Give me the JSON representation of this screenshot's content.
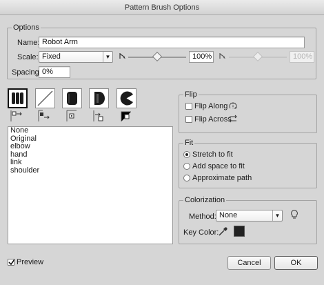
{
  "window": {
    "title": "Pattern Brush Options"
  },
  "options": {
    "legend": "Options",
    "name_label": "Name:",
    "name_value": "Robot Arm",
    "scale_label": "Scale:",
    "scale_selected": "Fixed",
    "scale_value": "100%",
    "scale_slider_level": 0.5,
    "scale_max_value": "100%",
    "scale_max_slider_level": 0.5,
    "spacing_label": "Spacing:",
    "spacing_value": "0%"
  },
  "tiles": [
    {
      "name": "side-tile",
      "selected": true
    },
    {
      "name": "outer-corner-tile",
      "selected": false
    },
    {
      "name": "inner-corner-tile",
      "selected": false
    },
    {
      "name": "start-tile",
      "selected": false
    },
    {
      "name": "end-tile",
      "selected": false
    }
  ],
  "pattern_list": {
    "items": [
      "None",
      "Original",
      "elbow",
      "hand",
      "link",
      "shoulder"
    ]
  },
  "flip": {
    "legend": "Flip",
    "flip_along_label": "Flip Along",
    "flip_along_checked": false,
    "flip_across_label": "Flip Across",
    "flip_across_checked": false
  },
  "fit": {
    "legend": "Fit",
    "options": [
      "Stretch to fit",
      "Add space to fit",
      "Approximate path"
    ],
    "selected_index": 0
  },
  "colorization": {
    "legend": "Colorization",
    "method_label": "Method:",
    "method_selected": "None",
    "key_color_label": "Key Color:",
    "key_color": "#222222"
  },
  "footer": {
    "preview_label": "Preview",
    "preview_checked": true,
    "cancel_label": "Cancel",
    "ok_label": "OK"
  }
}
